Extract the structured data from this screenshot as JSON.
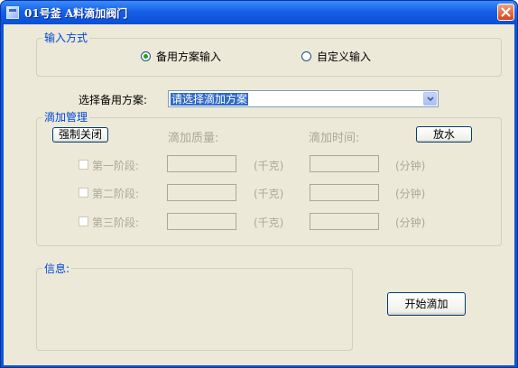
{
  "window": {
    "title": "01号釜 A料滴加阀门"
  },
  "input_mode": {
    "title": "输入方式",
    "options": [
      {
        "label": "备用方案输入",
        "checked": true
      },
      {
        "label": "自定义输入",
        "checked": false
      }
    ]
  },
  "backup_plan": {
    "label": "选择备用方案:",
    "value": "请选择滴加方案"
  },
  "drip": {
    "title": "滴加管理",
    "force_close": "强制关闭",
    "mass_header": "滴加质量:",
    "time_header": "滴加时间:",
    "drain": "放水",
    "stages": [
      {
        "label": "第一阶段:",
        "mass": "",
        "mass_unit": "(千克)",
        "time": "",
        "time_unit": "(分钟)",
        "checked": false
      },
      {
        "label": "第二阶段:",
        "mass": "",
        "mass_unit": "(千克)",
        "time": "",
        "time_unit": "(分钟)",
        "checked": false
      },
      {
        "label": "第三阶段:",
        "mass": "",
        "mass_unit": "(千克)",
        "time": "",
        "time_unit": "(分钟)",
        "checked": false
      }
    ]
  },
  "info": {
    "title": "信息:",
    "content": ""
  },
  "start_button": "开始滴加"
}
